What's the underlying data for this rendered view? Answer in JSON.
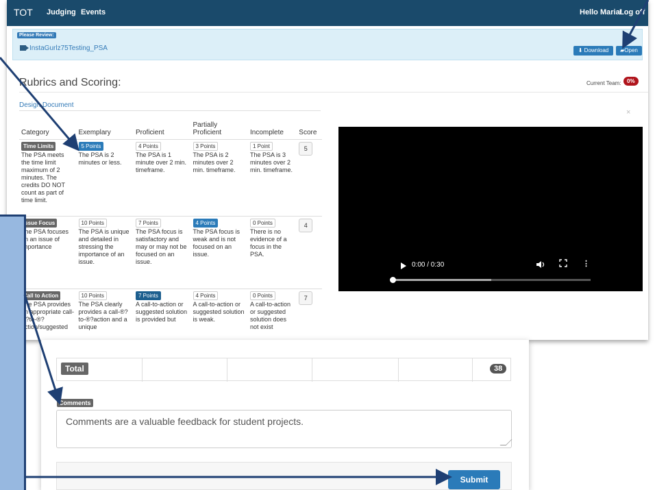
{
  "navbar": {
    "brand": "TOT",
    "items": [
      "Judging",
      "Events"
    ],
    "greeting": "Hello Maria!",
    "logoff": "Log off"
  },
  "review": {
    "label": "Please Review:",
    "filename": "InstaGurlz75Testing_PSA",
    "download": "Download",
    "open": "Open"
  },
  "rubric": {
    "title": "Rubrics and Scoring:",
    "current_team_label": "Current Team:",
    "current_team_pct": "0%",
    "doc_link": "Design Document",
    "close": "×",
    "headers": [
      "Category",
      "Exemplary",
      "Proficient",
      "Partially Proficient",
      "Incomplete",
      "Score"
    ],
    "rows": [
      {
        "category": "Time Limits",
        "category_desc": "The PSA meets the time limit maximum of 2 minutes. The credits DO NOT count as part of time limit.",
        "cells": [
          {
            "points": "5 Points",
            "text": "The PSA is 2 minutes or less."
          },
          {
            "points": "4 Points",
            "text": "The PSA is 1 minute over 2 min. timeframe."
          },
          {
            "points": "3 Points",
            "text": "The PSA is 2 minutes over 2 min. timeframe."
          },
          {
            "points": "1 Point",
            "text": "The PSA is 3 minutes over 2 min. timeframe."
          }
        ],
        "score": "5"
      },
      {
        "category": "Issue Focus",
        "category_desc": "The PSA focuses on an issue of importance",
        "cells": [
          {
            "points": "10 Points",
            "text": "The PSA is unique and detailed in stressing the importance of an issue."
          },
          {
            "points": "7 Points",
            "text": "The PSA focus is satisfactory and may or may not be focused on an issue."
          },
          {
            "points": "4 Points",
            "text": "The PSA focus is weak and is not focused on an issue."
          },
          {
            "points": "0 Points",
            "text": "There is no evidence of a focus in the PSA."
          }
        ],
        "score": "4"
      },
      {
        "category": "Call to Action",
        "category_desc": "The PSA provides an appropriate call-®?to-®? action/suggested",
        "cells": [
          {
            "points": "10 Points",
            "text": "The PSA clearly provides a call-®?to-®?action and a unique"
          },
          {
            "points": "7 Points",
            "text": "A call-to-action or suggested solution is provided but"
          },
          {
            "points": "4 Points",
            "text": "A call-to-action or suggested solution is weak."
          },
          {
            "points": "0 Points",
            "text": "A call-to-action or suggested solution does not exist"
          }
        ],
        "score": "7"
      }
    ]
  },
  "video": {
    "time": "0:00 / 0:30",
    "play_icon": "play-icon",
    "progress": 0.5
  },
  "bottom": {
    "total_label": "Total",
    "total_value": "38",
    "comments_label": "Comments",
    "comments_text": "Comments are a valuable feedback for student projects.",
    "submit": "Submit"
  },
  "colors": {
    "navbar": "#1a4a6b",
    "accent": "#2b7bb9",
    "overlay": "#97b8e0",
    "arrow": "#1e3f73",
    "badge_red": "#b0141c"
  }
}
